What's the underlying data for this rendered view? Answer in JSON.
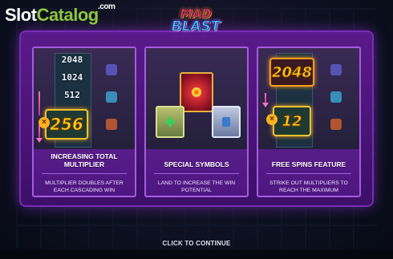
{
  "brand": {
    "part1": "Slot",
    "part2": "Catalog",
    "suffix": ".com"
  },
  "game_logo": {
    "line1": "MAD",
    "line2": "BLAST"
  },
  "cards": [
    {
      "title": "INCREASING TOTAL MULTIPLIER",
      "description": "MULTIPLIER DOUBLES AFTER EACH CASCADING WIN",
      "multipliers": [
        "2048",
        "1024",
        "512"
      ],
      "current_multiplier": "256",
      "x_symbol": "×"
    },
    {
      "title": "SPECIAL SYMBOLS",
      "description": "LAND TO INCREASE THE WIN POTENTIAL"
    },
    {
      "title": "FREE SPINS FEATURE",
      "description": "STRIKE OUT MULTIPLIERS TO REACH THE MAXIMUM",
      "top_multiplier": "2048",
      "current_multiplier": "12",
      "x_symbol": "×"
    }
  ],
  "cta": "CLICK TO CONTINUE",
  "colors": {
    "panel": "#4e1680",
    "accent": "#a65be0",
    "gold": "#ffd21a"
  }
}
